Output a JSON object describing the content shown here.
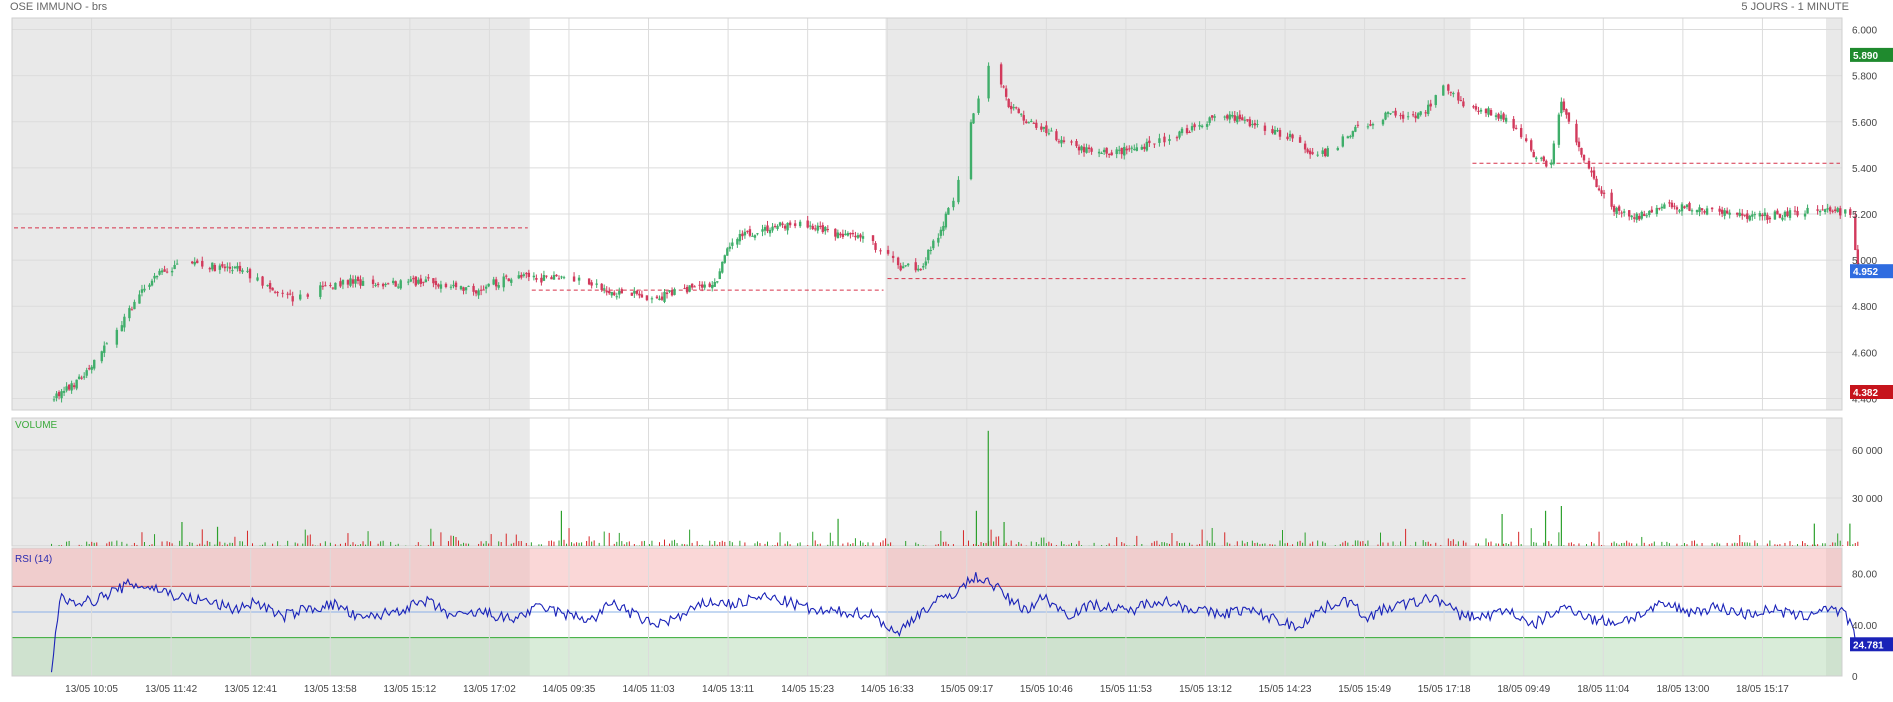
{
  "header": {
    "title": "OSE IMMUNO - brs",
    "period": "5 JOURS - 1 MINUTE"
  },
  "chart_data": [
    {
      "type": "candlestick",
      "title": "OSE IMMUNO - brs",
      "y_ticks": [
        "6.000",
        "5.800",
        "5.600",
        "5.400",
        "5.200",
        "5.000",
        "4.800",
        "4.600",
        "4.400"
      ],
      "ylim": [
        4.35,
        6.05
      ],
      "x_ticks": [
        "13/05 10:05",
        "13/05 11:42",
        "13/05 12:41",
        "13/05 13:58",
        "13/05 15:12",
        "13/05 17:02",
        "14/05 09:35",
        "14/05 11:03",
        "14/05 13:11",
        "14/05 15:23",
        "14/05 16:33",
        "15/05 09:17",
        "15/05 10:46",
        "15/05 11:53",
        "15/05 13:12",
        "15/05 14:23",
        "15/05 15:49",
        "15/05 17:18",
        "18/05 09:49",
        "18/05 11:04",
        "18/05 13:00",
        "18/05 15:17"
      ],
      "sessions": [
        {
          "day": "13/05",
          "shaded": true,
          "prev_close": 5.14
        },
        {
          "day": "14/05",
          "shaded": false,
          "prev_close": 4.87
        },
        {
          "day": "15/05",
          "shaded": true,
          "prev_close": 4.92
        },
        {
          "day": "18/05",
          "shaded": false,
          "prev_close": 5.42
        }
      ],
      "price_path": [
        [
          0,
          4.4
        ],
        [
          0.3,
          4.46
        ],
        [
          0.55,
          4.56
        ],
        [
          0.85,
          4.7
        ],
        [
          1.1,
          4.84
        ],
        [
          1.4,
          4.95
        ],
        [
          1.75,
          5.0
        ],
        [
          2.05,
          4.97
        ],
        [
          2.35,
          4.96
        ],
        [
          2.6,
          4.92
        ],
        [
          2.85,
          4.85
        ],
        [
          3.1,
          4.83
        ],
        [
          3.4,
          4.88
        ],
        [
          3.75,
          4.91
        ],
        [
          4.1,
          4.89
        ],
        [
          4.4,
          4.9
        ],
        [
          4.75,
          4.91
        ],
        [
          5.05,
          4.88
        ],
        [
          5.35,
          4.87
        ],
        [
          5.6,
          4.9
        ],
        [
          5.85,
          4.93
        ],
        [
          6.2,
          4.92
        ],
        [
          6.55,
          4.93
        ],
        [
          6.85,
          4.9
        ],
        [
          7.05,
          4.86
        ],
        [
          7.3,
          4.86
        ],
        [
          7.6,
          4.83
        ],
        [
          7.85,
          4.86
        ],
        [
          8.15,
          4.88
        ],
        [
          8.4,
          4.9
        ],
        [
          8.6,
          5.08
        ],
        [
          8.85,
          5.12
        ],
        [
          9.2,
          5.15
        ],
        [
          9.55,
          5.15
        ],
        [
          9.9,
          5.12
        ],
        [
          10.3,
          5.09
        ],
        [
          10.55,
          5.03
        ],
        [
          10.75,
          4.97
        ],
        [
          11.0,
          4.97
        ],
        [
          11.2,
          5.1
        ],
        [
          11.4,
          5.25
        ],
        [
          11.6,
          5.55
        ],
        [
          11.78,
          5.78
        ],
        [
          11.92,
          5.87
        ],
        [
          12.1,
          5.68
        ],
        [
          12.35,
          5.6
        ],
        [
          12.6,
          5.56
        ],
        [
          12.9,
          5.5
        ],
        [
          13.2,
          5.46
        ],
        [
          13.5,
          5.47
        ],
        [
          13.8,
          5.49
        ],
        [
          14.1,
          5.52
        ],
        [
          14.4,
          5.57
        ],
        [
          14.75,
          5.63
        ],
        [
          15.05,
          5.61
        ],
        [
          15.35,
          5.57
        ],
        [
          15.7,
          5.53
        ],
        [
          16.0,
          5.44
        ],
        [
          16.3,
          5.51
        ],
        [
          16.55,
          5.58
        ],
        [
          16.9,
          5.63
        ],
        [
          17.2,
          5.62
        ],
        [
          17.4,
          5.65
        ],
        [
          17.6,
          5.77
        ],
        [
          17.9,
          5.67
        ],
        [
          18.2,
          5.64
        ],
        [
          18.5,
          5.58
        ],
        [
          18.75,
          5.46
        ],
        [
          18.95,
          5.39
        ],
        [
          19.1,
          5.68
        ],
        [
          19.35,
          5.46
        ],
        [
          19.55,
          5.32
        ],
        [
          19.75,
          5.22
        ],
        [
          20.0,
          5.18
        ],
        [
          20.4,
          5.24
        ],
        [
          20.85,
          5.22
        ],
        [
          21.3,
          5.2
        ],
        [
          21.7,
          5.19
        ],
        [
          22.05,
          5.21
        ],
        [
          22.45,
          5.22
        ],
        [
          22.75,
          5.2
        ],
        [
          22.85,
          4.95
        ]
      ],
      "last_price": "5.890",
      "last_close": "4.952",
      "low_marker": "4.382"
    },
    {
      "type": "bar",
      "title": "VOLUME",
      "y_ticks": [
        "60 000",
        "30 000"
      ],
      "ylim": [
        0,
        80000
      ],
      "colors": {
        "up": "#2ca02c",
        "down": "#d62728"
      },
      "spikes": [
        {
          "x": 1.65,
          "v": 15000
        },
        {
          "x": 2.1,
          "v": 12000
        },
        {
          "x": 6.45,
          "v": 22000
        },
        {
          "x": 9.95,
          "v": 17000
        },
        {
          "x": 11.85,
          "v": 72000
        },
        {
          "x": 11.7,
          "v": 22000
        },
        {
          "x": 12.05,
          "v": 15000
        },
        {
          "x": 18.35,
          "v": 20000
        },
        {
          "x": 18.9,
          "v": 22000
        },
        {
          "x": 19.1,
          "v": 25000
        },
        {
          "x": 22.3,
          "v": 14000
        },
        {
          "x": 22.75,
          "v": 14000
        }
      ]
    },
    {
      "type": "line",
      "title": "RSI (14)",
      "y_ticks": [
        "80.00",
        "40.00",
        "0"
      ],
      "ylim": [
        0,
        100
      ],
      "upper_band": 70,
      "lower_band": 30,
      "midline": 50,
      "last_value": "24.781",
      "rsi_path": [
        [
          0,
          3
        ],
        [
          0.1,
          60
        ],
        [
          0.5,
          58
        ],
        [
          1.0,
          72
        ],
        [
          1.35,
          68
        ],
        [
          1.6,
          62
        ],
        [
          2.0,
          58
        ],
        [
          2.3,
          52
        ],
        [
          2.6,
          58
        ],
        [
          2.9,
          46
        ],
        [
          3.2,
          52
        ],
        [
          3.6,
          56
        ],
        [
          3.9,
          44
        ],
        [
          4.3,
          50
        ],
        [
          4.75,
          58
        ],
        [
          5.1,
          46
        ],
        [
          5.45,
          50
        ],
        [
          5.8,
          44
        ],
        [
          6.2,
          54
        ],
        [
          6.5,
          48
        ],
        [
          6.85,
          44
        ],
        [
          7.1,
          58
        ],
        [
          7.3,
          50
        ],
        [
          7.6,
          40
        ],
        [
          7.95,
          46
        ],
        [
          8.3,
          58
        ],
        [
          8.65,
          56
        ],
        [
          9.0,
          62
        ],
        [
          9.3,
          58
        ],
        [
          9.7,
          50
        ],
        [
          10.05,
          50
        ],
        [
          10.4,
          48
        ],
        [
          10.7,
          32
        ],
        [
          10.9,
          46
        ],
        [
          11.2,
          58
        ],
        [
          11.45,
          66
        ],
        [
          11.7,
          78
        ],
        [
          11.9,
          72
        ],
        [
          12.15,
          58
        ],
        [
          12.35,
          52
        ],
        [
          12.55,
          62
        ],
        [
          12.85,
          48
        ],
        [
          13.2,
          56
        ],
        [
          13.6,
          50
        ],
        [
          14.0,
          60
        ],
        [
          14.35,
          54
        ],
        [
          14.75,
          48
        ],
        [
          15.1,
          52
        ],
        [
          15.5,
          44
        ],
        [
          15.75,
          38
        ],
        [
          16.0,
          50
        ],
        [
          16.35,
          60
        ],
        [
          16.65,
          46
        ],
        [
          16.95,
          54
        ],
        [
          17.3,
          58
        ],
        [
          17.5,
          62
        ],
        [
          17.8,
          48
        ],
        [
          18.1,
          46
        ],
        [
          18.45,
          52
        ],
        [
          18.7,
          38
        ],
        [
          18.95,
          48
        ],
        [
          19.2,
          54
        ],
        [
          19.5,
          44
        ],
        [
          19.8,
          42
        ],
        [
          20.1,
          48
        ],
        [
          20.4,
          56
        ],
        [
          20.75,
          50
        ],
        [
          21.05,
          54
        ],
        [
          21.45,
          48
        ],
        [
          21.75,
          52
        ],
        [
          22.15,
          46
        ],
        [
          22.45,
          54
        ],
        [
          22.7,
          48
        ],
        [
          22.85,
          25
        ]
      ]
    }
  ]
}
